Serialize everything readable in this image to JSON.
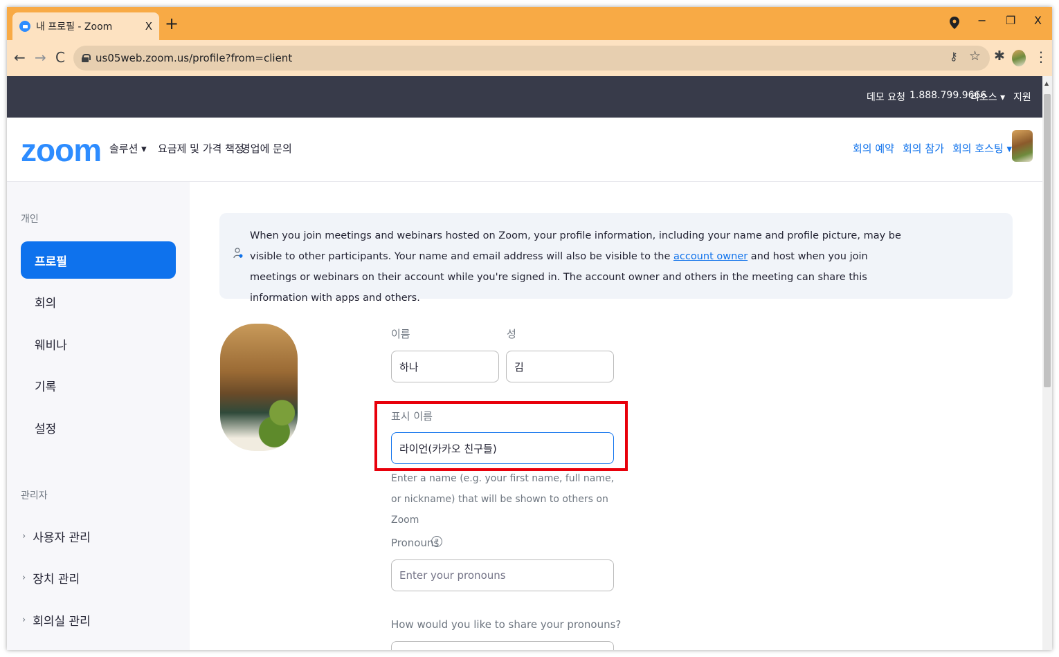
{
  "browser": {
    "tab_title": "내 프로필 - Zoom",
    "tab_close": "X",
    "new_tab": "+",
    "url": "us05web.zoom.us/profile?from=client",
    "back": "←",
    "forward": "→",
    "reload": "C",
    "win_minimize": "−",
    "win_restore": "❐",
    "win_close": "X",
    "key_icon": "⚷",
    "star_icon": "☆",
    "extensions_icon": "✱",
    "menu_icon": "⋮"
  },
  "topbar": {
    "demo": "데모 요청",
    "phone": "1.888.799.9666",
    "resources": "리소스 ▾",
    "support": "지원"
  },
  "header": {
    "logo": "zoom",
    "nav": [
      "솔루션 ▾",
      "요금제 및 가격 책정",
      "영업에 문의"
    ],
    "schedule": "회의 예약",
    "join": "회의 참가",
    "host": "회의 호스팅 ▾"
  },
  "sidebar": {
    "personal_heading": "개인",
    "items": [
      "프로필",
      "회의",
      "웨비나",
      "기록",
      "설정"
    ],
    "admin_heading": "관리자",
    "admin_items": [
      "사용자 관리",
      "장치 관리",
      "회의실 관리"
    ],
    "chevron": "›"
  },
  "notice": {
    "text_before": "When you join meetings and webinars hosted on Zoom, your profile information, including your name and profile picture, may be visible to other participants. Your name and email address will also be visible to the ",
    "link": "account owner",
    "text_after": " and host when you join meetings or webinars on their account while you're signed in. The account owner and others in the meeting can share this information with apps and others."
  },
  "form": {
    "first_name_label": "이름",
    "first_name_value": "하나",
    "last_name_label": "성",
    "last_name_value": "김",
    "display_name_label": "표시 이름",
    "display_name_value": "라이언(카카오 친구들)",
    "display_name_helper": "Enter a name (e.g. your first name, full name, or nickname) that will be shown to others on Zoom",
    "pronouns_label": "Pronouns",
    "pronouns_help": "?",
    "pronouns_placeholder": "Enter your pronouns",
    "share_pronouns_label": "How would you like to share your pronouns?"
  },
  "colors": {
    "accent": "#0e72ed",
    "highlight": "#e8000b",
    "tabbar": "#f8aa45"
  }
}
